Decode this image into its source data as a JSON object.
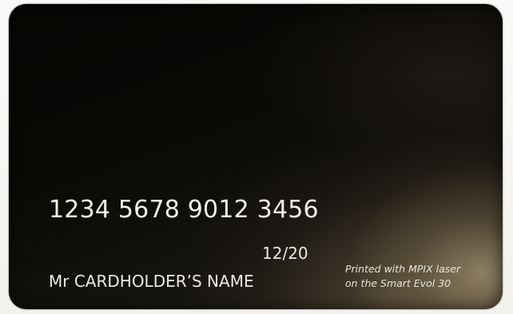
{
  "card": {
    "number": "1234 5678 9012 3456",
    "expiry": "12/20",
    "holder_name": "Mr CARDHOLDER’S NAME",
    "printed_note": {
      "line1": "Printed with MPIX laser",
      "line2": "on the Smart Evol 30"
    }
  }
}
